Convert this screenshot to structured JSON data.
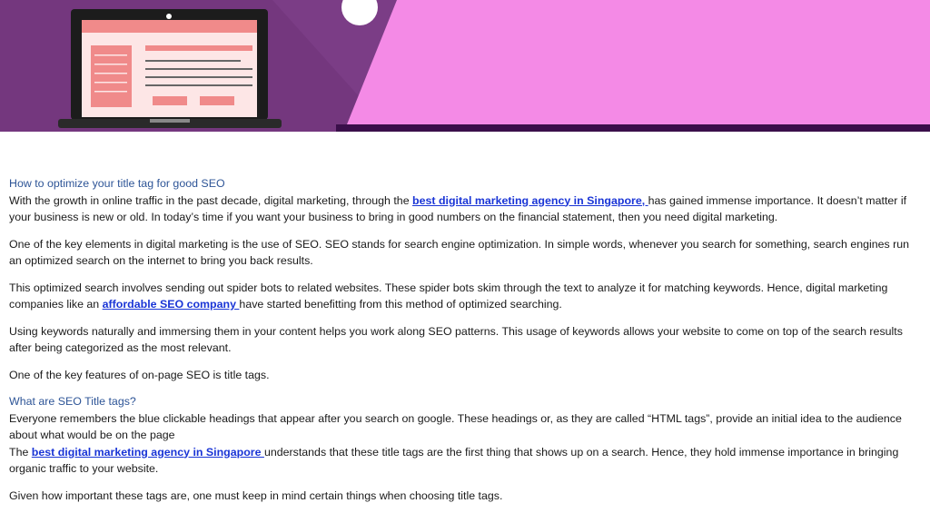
{
  "colors": {
    "banner_left": "#7b3d86",
    "banner_right": "#f48ae6",
    "banner_bottom_strip": "#3a0f4a",
    "heading": "#2e5597",
    "link": "#1a35d6",
    "laptop_screen": "#fde6e6",
    "laptop_accent": "#f08a8a"
  },
  "banner": {
    "image_icon": "laptop-with-webpage-illustration"
  },
  "section1": {
    "heading": "How to optimize your title tag for good SEO",
    "p1_a": "With the growth in online traffic in the past decade, digital marketing, through the ",
    "p1_link": "best digital marketing agency in Singapore, ",
    "p1_b": "has gained immense importance. It doesn’t matter if your business is new or old. In today’s time if you want your business to bring in good numbers on the financial statement, then you need digital marketing.",
    "p2": "One of the key elements in digital marketing is the use of SEO. SEO stands for search engine optimization. In simple words, whenever you search for something, search engines run an optimized search on the internet to bring you back results.",
    "p3_a": "This optimized search involves sending out spider bots to related websites. These spider bots skim through the text to analyze it for matching keywords. Hence, digital marketing companies like an ",
    "p3_link": "affordable SEO company ",
    "p3_b": "have started benefitting from this method of optimized searching.",
    "p4": "Using keywords naturally and immersing them in your content helps you work along SEO patterns. This usage of keywords allows your website to come on top of the search results after being categorized as the most relevant.",
    "p5": "One of the key features of on-page SEO is title tags."
  },
  "section2": {
    "heading": "What are SEO Title tags?",
    "p1": "Everyone remembers the blue clickable headings that appear after you search on google. These headings or, as they are called “HTML tags”, provide an initial idea to the audience about what would be on the page",
    "p2_a": "The ",
    "p2_link": "best digital marketing agency in Singapore ",
    "p2_b": "understands that these title tags are the first thing that shows up on a search. Hence, they hold immense importance in bringing organic traffic to your website.",
    "p3": "Given how important these tags are, one must keep in mind certain things when choosing title tags."
  }
}
